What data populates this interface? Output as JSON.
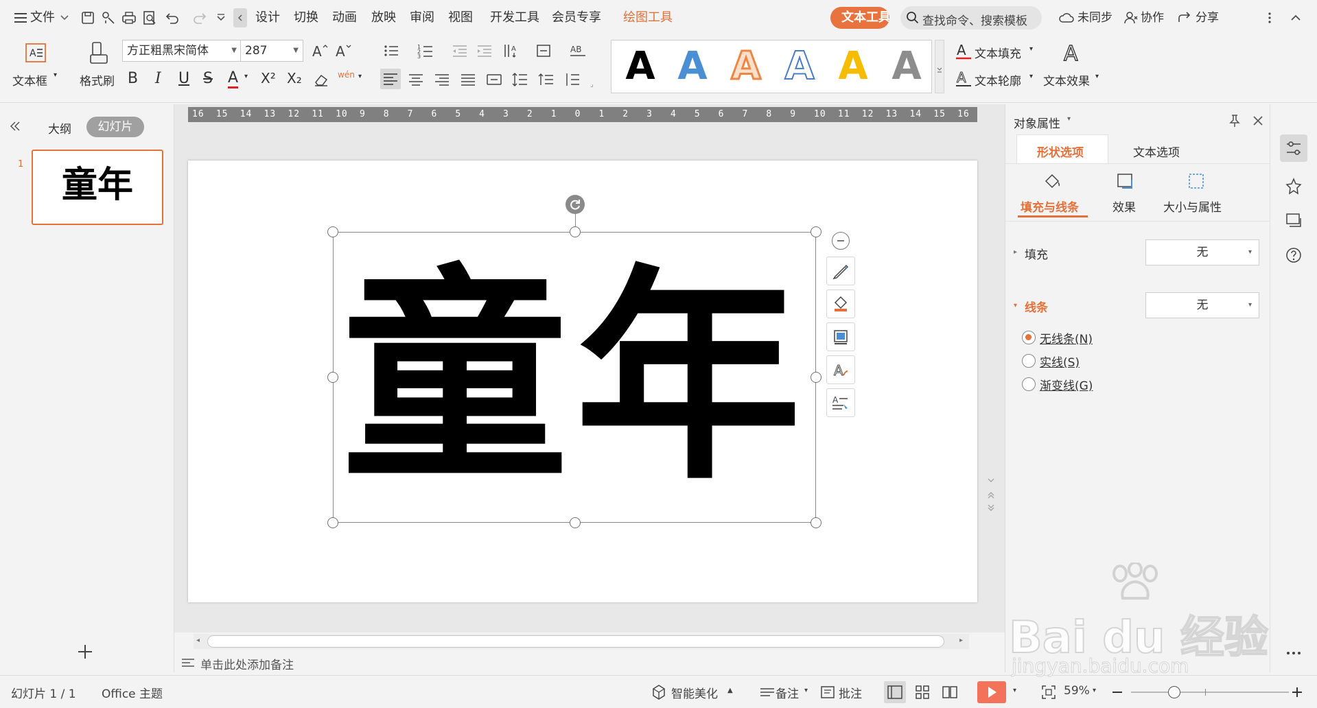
{
  "menubar": {
    "file_label": "文件",
    "tabs": [
      "设计",
      "切换",
      "动画",
      "放映",
      "审阅",
      "视图",
      "开发工具",
      "会员专享"
    ],
    "drawing_tools": "绘图工具",
    "text_tools": "文本工具",
    "search_placeholder": "查找命令、搜索模板",
    "sync_label": "未同步",
    "collab_label": "协作",
    "share_label": "分享"
  },
  "ribbon": {
    "textbox_label": "文本框",
    "format_painter_label": "格式刷",
    "font_name": "方正粗黑宋简体",
    "font_size": "287",
    "bold": "B",
    "italic": "I",
    "underline": "U",
    "strike": "S",
    "font_color": "A",
    "superscript": "X²",
    "subscript": "X₂",
    "pinyin": "wén",
    "style_gallery_letter": "A",
    "text_fill_label": "文本填充",
    "text_outline_label": "文本轮廓",
    "text_effect_label": "文本效果"
  },
  "left_panel": {
    "outline_tab": "大纲",
    "slides_tab": "幻灯片",
    "slide_number": "1",
    "thumb_text": "童年"
  },
  "slide": {
    "text": "童年",
    "ruler_labels": [
      "16",
      "15",
      "14",
      "13",
      "12",
      "11",
      "10",
      "9",
      "8",
      "7",
      "6",
      "5",
      "4",
      "3",
      "2",
      "1",
      "0",
      "1",
      "2",
      "3",
      "4",
      "5",
      "6",
      "7",
      "8",
      "9",
      "10",
      "11",
      "12",
      "13",
      "14",
      "15",
      "16"
    ]
  },
  "notes": {
    "placeholder": "单击此处添加备注"
  },
  "right_panel": {
    "title": "对象属性",
    "tab_shape": "形状选项",
    "tab_text": "文本选项",
    "sub_fill_line": "填充与线条",
    "sub_effect": "效果",
    "sub_size": "大小与属性",
    "fill_label": "填充",
    "fill_value": "无",
    "line_label": "线条",
    "line_value": "无",
    "radio_none": "无线条(N)",
    "radio_solid": "实线(S)",
    "radio_gradient": "渐变线(G)"
  },
  "statusbar": {
    "slide_info": "幻灯片 1 / 1",
    "theme": "Office 主题",
    "smart_beautify": "智能美化",
    "notes": "备注",
    "comments": "批注",
    "zoom": "59%"
  },
  "watermark": {
    "brand": "Bai du 经验",
    "url": "jingyan.baidu.com"
  },
  "colors": {
    "accent": "#e4713a",
    "text_tools_bg": "#e8733f",
    "play": "#f2735a"
  },
  "zoom_level": {
    "percent": 59
  }
}
